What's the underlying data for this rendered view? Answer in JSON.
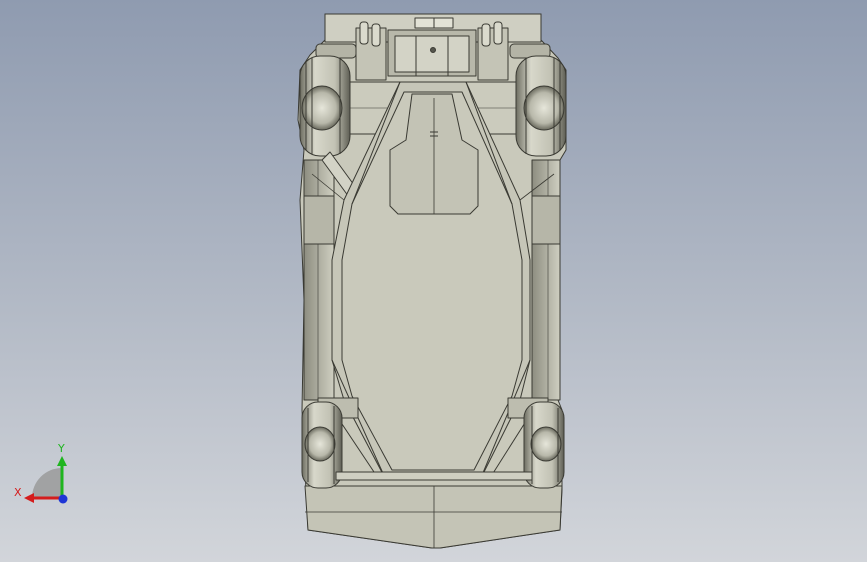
{
  "viewport": {
    "background_top": "#8f9bb0",
    "background_bottom": "#d2d5da"
  },
  "model": {
    "view": "bottom",
    "body_color": "#c9c9bb",
    "shade_color": "#a9a99b",
    "line_color": "#3a3a33"
  },
  "triad": {
    "x_label": "X",
    "y_label": "Y",
    "x_color": "#d41c1c",
    "y_color": "#1fb51f",
    "z_color": "#1e35d6",
    "x_icon": "x-axis-arrow-icon",
    "y_icon": "y-axis-arrow-icon",
    "z_icon": "z-axis-dot-icon"
  }
}
